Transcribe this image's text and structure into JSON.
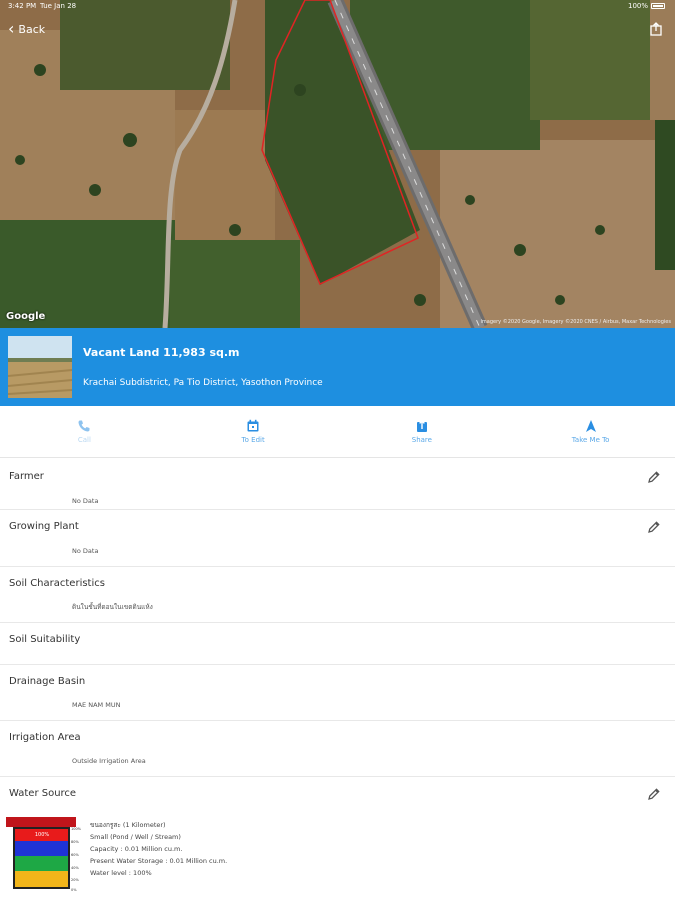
{
  "status_bar": {
    "time": "3:42 PM",
    "date": "Tue Jan 28",
    "battery": "100%"
  },
  "nav": {
    "back_label": "Back"
  },
  "map": {
    "provider": "Google",
    "credit": "Imagery ©2020 Google, Imagery ©2020 CNES / Airbus, Maxar Technologies"
  },
  "header": {
    "title": "Vacant Land 11,983 sq.m",
    "subtitle": "Krachai Subdistrict, Pa Tio District, Yasothon Province"
  },
  "actions": [
    {
      "label": "Call",
      "icon": "phone-icon"
    },
    {
      "label": "To Edit",
      "icon": "calendar-edit-icon"
    },
    {
      "label": "Share",
      "icon": "share-icon"
    },
    {
      "label": "Take Me To",
      "icon": "navigation-arrow-icon"
    }
  ],
  "sections": {
    "farmer": {
      "title": "Farmer",
      "value": "No Data"
    },
    "growing_plant": {
      "title": "Growing Plant",
      "value": "No Data"
    },
    "soil_characteristics": {
      "title": "Soil Characteristics",
      "value": "ดินในชั้นที่ดอนในเขตดินแห้ง"
    },
    "soil_suitability": {
      "title": "Soil Suitability",
      "value": ""
    },
    "drainage_basin": {
      "title": "Drainage Basin",
      "value": "MAE NAM MUN"
    },
    "irrigation_area": {
      "title": "Irrigation Area",
      "value": "Outside Irrigation Area"
    },
    "water_source": {
      "title": "Water Source",
      "lines": [
        "ขนองกรูสะ  (1 Kilometer)",
        "Small (Pond / Well / Stream)",
        "Capacity : 0.01 Million cu.m.",
        "Present Water Storage : 0.01 Million cu.m.",
        "Water level : 100%"
      ],
      "tank_label": "100%",
      "level_labels": [
        "100%",
        "80%",
        "60%",
        "40%",
        "20%",
        "0%"
      ],
      "level_percent": 100,
      "colors": [
        "#e81b1b",
        "#1f33d6",
        "#1ea845",
        "#f2b51a"
      ]
    }
  }
}
